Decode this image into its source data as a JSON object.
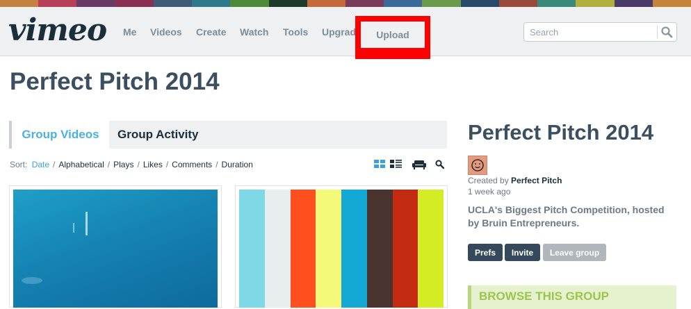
{
  "header": {
    "logo_text": "vimeo",
    "nav": [
      "Me",
      "Videos",
      "Create",
      "Watch",
      "Tools",
      "Upgrad"
    ],
    "upload_label": "Upload",
    "search_placeholder": "Search",
    "stripe_colors": [
      "#c3823f",
      "#b73f57",
      "#6a3a67",
      "#8b2f52",
      "#3e5c7a",
      "#2f7a8a",
      "#4e8a3a",
      "#1e3a2a",
      "#c46a3a",
      "#7a3a5c",
      "#3a6a9a",
      "#6a9a4a",
      "#2a4a6a",
      "#9a4a3a",
      "#3a8a7a",
      "#b0b040",
      "#4a3a6a",
      "#c4843a"
    ],
    "highlight_color": "#ff0000"
  },
  "page": {
    "title": "Perfect Pitch 2014"
  },
  "tabs": [
    {
      "label": "Group Videos",
      "active": true
    },
    {
      "label": "Group Activity",
      "active": false
    }
  ],
  "sort": {
    "label": "Sort:",
    "options": [
      "Date",
      "Alphabetical",
      "Plays",
      "Likes",
      "Comments",
      "Duration"
    ],
    "active": "Date"
  },
  "videos": [
    {
      "thumb": "underwater"
    },
    {
      "thumb": "color-stripes",
      "stripes": [
        "#7fd8e6",
        "#e8eef0",
        "#ff4f1e",
        "#f4f97a",
        "#13a9d4",
        "#4a342f",
        "#c42a0f",
        "#d3ec24"
      ]
    }
  ],
  "sidebar": {
    "title": "Perfect Pitch 2014",
    "created_prefix": "Created by",
    "creator": "Perfect Pitch",
    "time_ago": "1 week ago",
    "description": "UCLA's Biggest Pitch Competition, hosted by Bruin Entrepreneurs.",
    "buttons": {
      "prefs": "Prefs",
      "invite": "Invite",
      "leave": "Leave group"
    },
    "browse_heading": "BROWSE THIS GROUP"
  }
}
